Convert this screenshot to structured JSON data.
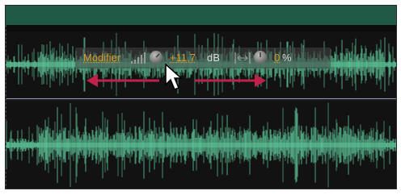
{
  "hud": {
    "modifier_label": "Modifier",
    "gain_value": "+11,7",
    "gain_unit": "dB",
    "stretch_value": "0",
    "stretch_unit": "%"
  },
  "icons": {
    "volume": "volume-bars-icon",
    "gain_knob": "knob-icon",
    "stretch": "stretch-icon",
    "stretch_knob": "knob-icon",
    "move_arrows": "double-arrow-icon",
    "cursor": "mouse-pointer-icon"
  },
  "colors": {
    "waveform": "#5ec79a",
    "time_bar": "#1f5a46",
    "accent_value": "#d99b2a",
    "arrow": "#c0214a",
    "channel_divider": "#8f96b4"
  }
}
